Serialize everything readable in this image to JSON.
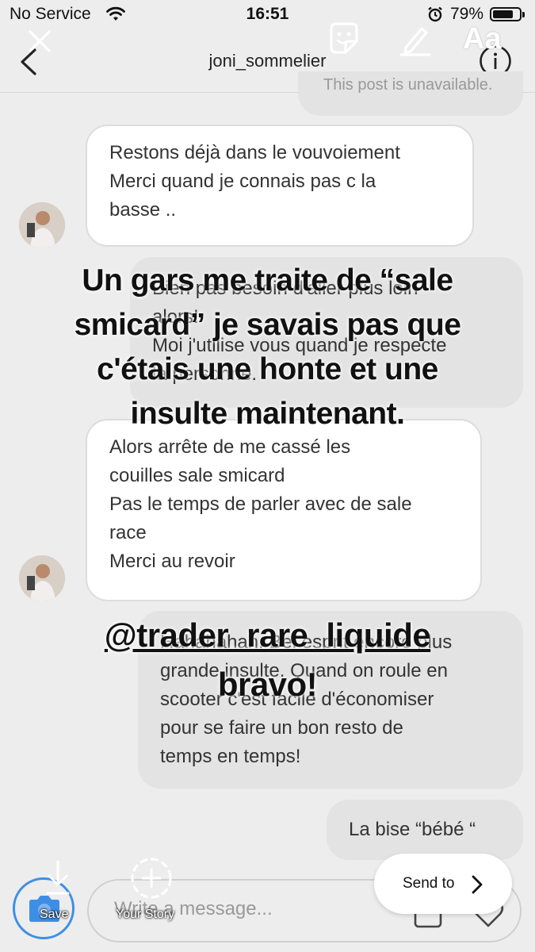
{
  "status_bar": {
    "carrier": "No Service",
    "time": "16:51",
    "battery": "79%",
    "battery_level": 0.79
  },
  "header": {
    "username": "joni_sommelier"
  },
  "story_tools": {
    "text_tool_label": "Aa"
  },
  "messages": [
    {
      "from": "them",
      "lines": [
        "Restons déjà dans le vouvoiement",
        "Merci quand je connais pas c la",
        "basse .."
      ]
    },
    {
      "from": "me",
      "lines": [
        "Bien pas besoin d'aller plus loin",
        "alors!",
        "Moi j'utilise vous quand je respecte",
        "la personne."
      ]
    },
    {
      "from": "them",
      "lines": [
        "Alors arrête de me cassé les",
        "couilles sale smicard",
        "Pas le temps de parler avec de sale",
        "race",
        "Merci au revoir"
      ]
    },
    {
      "from": "me",
      "lines": [
        "Hahahahah. Bel esprit encore plus",
        "grande insulte. Quand on roule en",
        "scooter c'est facile d'économiser",
        "pour se faire un bon resto de",
        "temps en temps!"
      ]
    },
    {
      "from": "me",
      "lines": [
        "La bise “bébé “"
      ]
    }
  ],
  "partial_message": "This post is unavailable.",
  "story_overlay": {
    "caption_lines": [
      "Un gars me traite de “sale",
      "smicard” je savais pas que",
      "c'étais une honte et une",
      "insulte maintenant."
    ],
    "mention_lines": [
      "@trader_rare_liquide",
      "bravo!"
    ]
  },
  "composer": {
    "placeholder": "Write a message..."
  },
  "story_footer": {
    "save_label": "Save",
    "your_story_label": "Your Story",
    "send_to_label": "Send to"
  },
  "colors": {
    "background": "#ededed",
    "received_bubble": "#ffffff",
    "sent_bubble": "#e3e3e3",
    "camera_ring": "#3d8fe6"
  }
}
